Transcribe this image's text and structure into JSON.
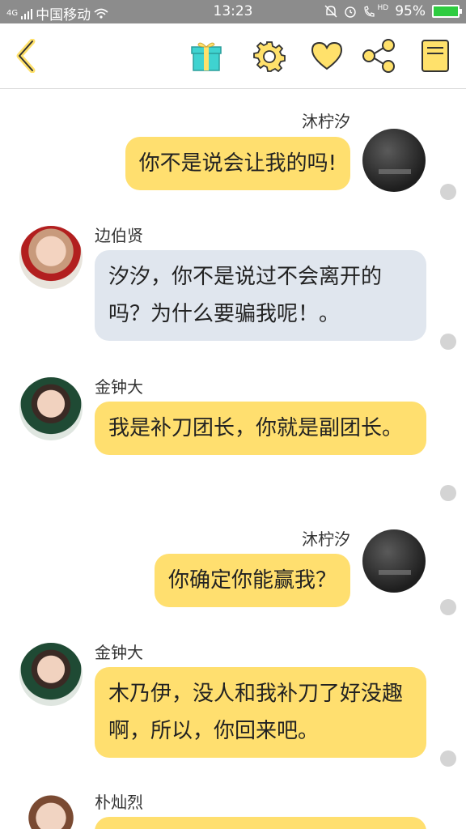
{
  "status_bar": {
    "signal_tag": "4G",
    "carrier": "中国移动",
    "time": "13:23",
    "hd": "HD",
    "battery": "95%"
  },
  "toolbar": {
    "back_icon": "chevron-left-icon",
    "gift_icon": "gift-icon",
    "settings_icon": "gear-icon",
    "favorite_icon": "heart-icon",
    "share_icon": "share-icon",
    "notes_icon": "notebook-icon",
    "accent": "#ffe16b"
  },
  "messages": [
    {
      "sender": "沐柠汐",
      "side": "right",
      "text": "你不是说会让我的吗!",
      "color": "#ffdf6f"
    },
    {
      "sender": "边伯贤",
      "side": "left",
      "text": "汐汐，你不是说过不会离开的吗？为什么要骗我呢！。",
      "color": "#e0e6ee"
    },
    {
      "sender": "金钟大",
      "side": "left",
      "text": "我是补刀团长，你就是副团长。",
      "color": "#ffdf6f"
    },
    {
      "sender": "沐柠汐",
      "side": "right",
      "text": "你确定你能赢我？",
      "color": "#ffdf6f"
    },
    {
      "sender": "金钟大",
      "side": "left",
      "text": "木乃伊，没人和我补刀了好没趣啊，所以，你回来吧。",
      "color": "#ffdf6f"
    },
    {
      "sender": "朴灿烈",
      "side": "left",
      "text": "",
      "color": "#ffdf6f"
    }
  ]
}
